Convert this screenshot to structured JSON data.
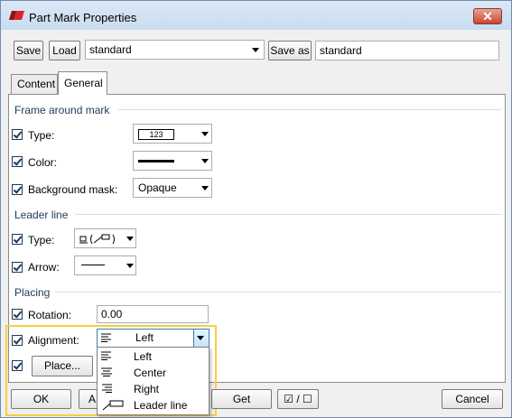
{
  "window": {
    "title": "Part Mark Properties",
    "close_glyph": "✕",
    "app_icon": "part-mark-icon"
  },
  "toolbar": {
    "save_label": "Save",
    "load_label": "Load",
    "preset_value": "standard",
    "save_as_label": "Save as",
    "save_as_value": "standard"
  },
  "tabs": [
    {
      "label": "Content",
      "active": false
    },
    {
      "label": "General",
      "active": true
    }
  ],
  "frame_section": {
    "title": "Frame around mark",
    "type_label": "Type:",
    "type_value": "123",
    "color_label": "Color:",
    "background_label": "Background mask:",
    "background_value": "Opaque"
  },
  "leader_section": {
    "title": "Leader line",
    "type_label": "Type:",
    "arrow_label": "Arrow:"
  },
  "placing_section": {
    "title": "Placing",
    "rotation_label": "Rotation:",
    "rotation_value": "0.00",
    "alignment_label": "Alignment:",
    "alignment_value": "Left",
    "place_label": "Place..."
  },
  "alignment_options": [
    "Left",
    "Center",
    "Right",
    "Leader line"
  ],
  "footer": {
    "ok_label": "OK",
    "apply_label": "A",
    "get_label": "Get",
    "toggle_label": "☑ / ☐",
    "cancel_label": "Cancel"
  },
  "colors": {
    "accent": "#1e395b",
    "highlight": "#f5cf45",
    "icon_red": "#d8262d"
  }
}
